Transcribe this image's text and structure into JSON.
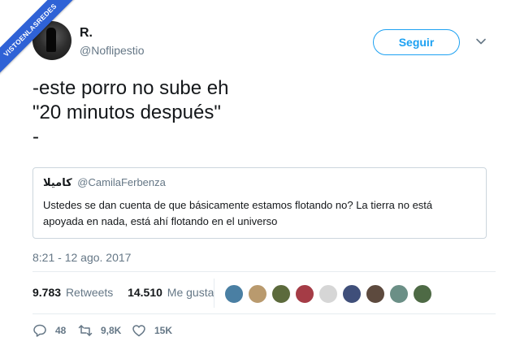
{
  "watermark": {
    "text": "VISTOENLASREDES",
    "color": "#2f62d6"
  },
  "tweet": {
    "author_name": "R.",
    "author_handle": "@Noflipestio",
    "follow_label": "Seguir",
    "text": "-este porro no sube eh\n\"20 minutos después\"\n-",
    "quoted": {
      "name": "كاميلا",
      "handle": "@CamilaFerbenza",
      "text": "Ustedes se dan cuenta de que básicamente estamos flotando no? La tierra no está apoyada en nada, está ahí flotando en el universo"
    },
    "timestamp": "8:21 - 12 ago. 2017",
    "stats": {
      "retweets_count": "9.783",
      "retweets_label": "Retweets",
      "likes_count": "14.510",
      "likes_label": "Me gusta"
    },
    "actions": {
      "reply_count": "48",
      "retweet_count": "9,8K",
      "like_count": "15K"
    }
  },
  "colors": {
    "accent": "#1da1f2",
    "muted": "#657786",
    "text": "#14171a",
    "border": "#ccd6dd"
  },
  "liker_avatars": [
    {
      "name": "liker-avatar-1",
      "color": "#4a7fa3"
    },
    {
      "name": "liker-avatar-2",
      "color": "#b99a6e"
    },
    {
      "name": "liker-avatar-3",
      "color": "#5c6a3c"
    },
    {
      "name": "liker-avatar-4",
      "color": "#a53c46"
    },
    {
      "name": "liker-avatar-5",
      "color": "#d6d6d6"
    },
    {
      "name": "liker-avatar-6",
      "color": "#3f4f7a"
    },
    {
      "name": "liker-avatar-7",
      "color": "#5d4a3e"
    },
    {
      "name": "liker-avatar-8",
      "color": "#6b8f86"
    },
    {
      "name": "liker-avatar-9",
      "color": "#4e6a45"
    }
  ]
}
